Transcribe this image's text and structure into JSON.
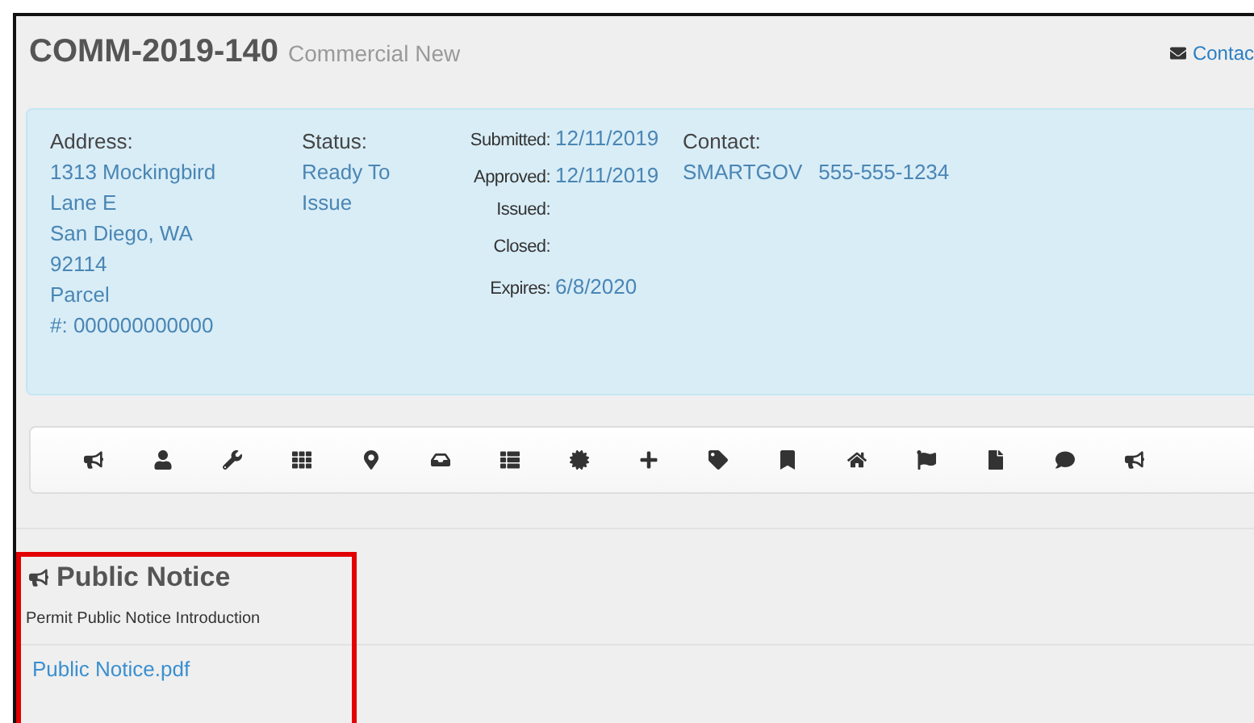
{
  "header": {
    "title": "COMM-2019-140",
    "subtitle": "Commercial New",
    "contact_link": "Contac"
  },
  "info": {
    "address": {
      "label": "Address:",
      "lines": [
        "1313 Mockingbird",
        "Lane E",
        "San Diego,  WA",
        "92114",
        "Parcel",
        "#: 000000000000"
      ]
    },
    "status": {
      "label": "Status:",
      "lines": [
        "Ready To",
        "Issue"
      ]
    },
    "dates": [
      {
        "label": "Submitted:",
        "value": "12/11/2019"
      },
      {
        "label": "Approved:",
        "value": "12/11/2019"
      },
      {
        "label": "Issued:"
      },
      {
        "label": "Closed:"
      },
      {
        "label": "Expires:",
        "value": "6/8/2020"
      }
    ],
    "contact": {
      "label": "Contact:",
      "name": "SMARTGOV",
      "phone": "555-555-1234"
    }
  },
  "toolbar": [
    {
      "kind": "bullhorn"
    },
    {
      "kind": "user"
    },
    {
      "kind": "wrench"
    },
    {
      "kind": "grid"
    },
    {
      "kind": "marker"
    },
    {
      "kind": "inbox"
    },
    {
      "kind": "list"
    },
    {
      "kind": "certificate"
    },
    {
      "kind": "plus"
    },
    {
      "kind": "tag"
    },
    {
      "kind": "bookmark"
    },
    {
      "kind": "home"
    },
    {
      "kind": "flag"
    },
    {
      "kind": "file"
    },
    {
      "kind": "comment"
    },
    {
      "kind": "bullhorn"
    }
  ],
  "section": {
    "title": "Public Notice",
    "intro": "Permit Public Notice Introduction",
    "file": "Public Notice.pdf",
    "highlighted": true
  }
}
